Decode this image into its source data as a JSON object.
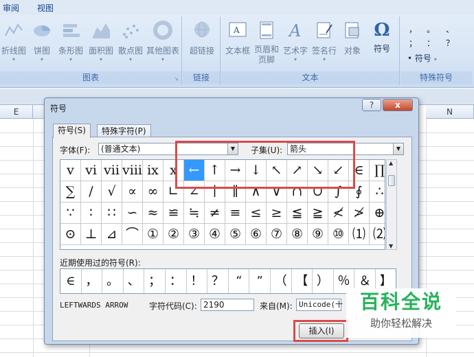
{
  "menu": {
    "tab_review": "审阅",
    "tab_view": "视图"
  },
  "ribbon": {
    "charts": {
      "buttons": [
        {
          "label": "折线图",
          "icon": "line-chart-icon"
        },
        {
          "label": "饼图",
          "icon": "pie-chart-icon"
        },
        {
          "label": "条形图",
          "icon": "bar-chart-icon"
        },
        {
          "label": "面积图",
          "icon": "area-chart-icon"
        },
        {
          "label": "散点图",
          "icon": "scatter-chart-icon"
        },
        {
          "label": "其他图表",
          "icon": "other-chart-icon"
        }
      ],
      "group_label": "图表"
    },
    "links": {
      "hyperlink_label": "超链接",
      "group_label": "链接"
    },
    "text": {
      "textbox_label": "文本框",
      "header_footer_label": "页眉和页脚",
      "wordart_label": "艺术字",
      "signature_label": "签名行",
      "object_label": "对象",
      "symbol_label": "符号",
      "group_label": "文本"
    },
    "special": {
      "symbol_label": "符号",
      "preview_glyphs": [
        "，",
        "。",
        "、",
        "；",
        "：",
        "？"
      ],
      "group_label": "特殊符号"
    }
  },
  "sheet": {
    "col_e": "E",
    "col_n": "N"
  },
  "dialog": {
    "title": "符号",
    "help": "?",
    "close": "x",
    "tabs": {
      "symbols": "符号(S)",
      "special": "特殊字符(P)"
    },
    "font_label": "字体(F):",
    "font_value": "(普通文本)",
    "subset_label": "子集(U):",
    "subset_value": "箭头",
    "symbols": [
      "v",
      "vi",
      "vii",
      "viii",
      "ix",
      "x",
      "←",
      "↑",
      "→",
      "↓",
      "↖",
      "↗",
      "↘",
      "↙",
      "∈",
      "∏",
      "∑",
      "∕",
      "√",
      "∝",
      "∞",
      "∟",
      "∠",
      "∣",
      "∥",
      "∧",
      "∨",
      "∩",
      "∪",
      "∫",
      "∮",
      "∴",
      "∵",
      "∶",
      "∷",
      "∽",
      "≈",
      "≌",
      "≒",
      "≠",
      "≡",
      "≤",
      "≥",
      "≦",
      "≧",
      "≮",
      "≯",
      "⊕",
      "⊙",
      "⊥",
      "⊿",
      "⌒",
      "①",
      "②",
      "③",
      "④",
      "⑤",
      "⑥",
      "⑦",
      "⑧",
      "⑨",
      "⑩",
      "⑴",
      "⑵"
    ],
    "recent_label": "近期使用过的符号(R):",
    "recent_symbols": [
      "∈",
      "，",
      "。",
      "、",
      "；",
      "：",
      "！",
      "？",
      "“",
      "”",
      "（",
      "【",
      "）",
      "％",
      "＆",
      "】"
    ],
    "char_name": "LEFTWARDS ARROW",
    "char_code_label": "字符代码(C):",
    "char_code_value": "2190",
    "from_label": "来自(M):",
    "from_value": "Unicode(十",
    "insert_label": "插入(I)"
  },
  "watermark": {
    "title": "百科全说",
    "subtitle": "助你轻松解决"
  }
}
